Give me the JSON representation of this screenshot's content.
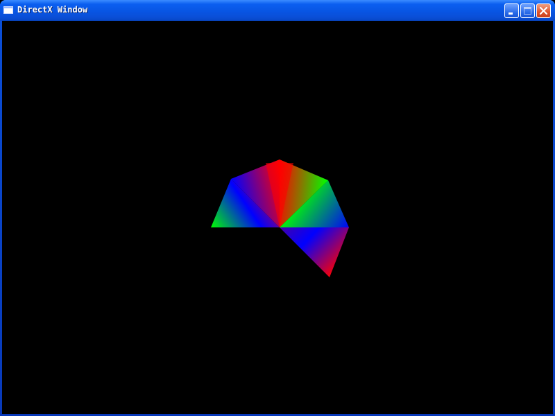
{
  "window": {
    "title": "DirectX Window",
    "icon": "app-window-icon",
    "buttons": {
      "minimize": "minimize-icon",
      "maximize": "maximize-icon",
      "close": "close-icon"
    }
  },
  "scene": {
    "background": "#000000",
    "description_colors": [
      "#ff0000",
      "#00ff00",
      "#0000ff"
    ]
  }
}
